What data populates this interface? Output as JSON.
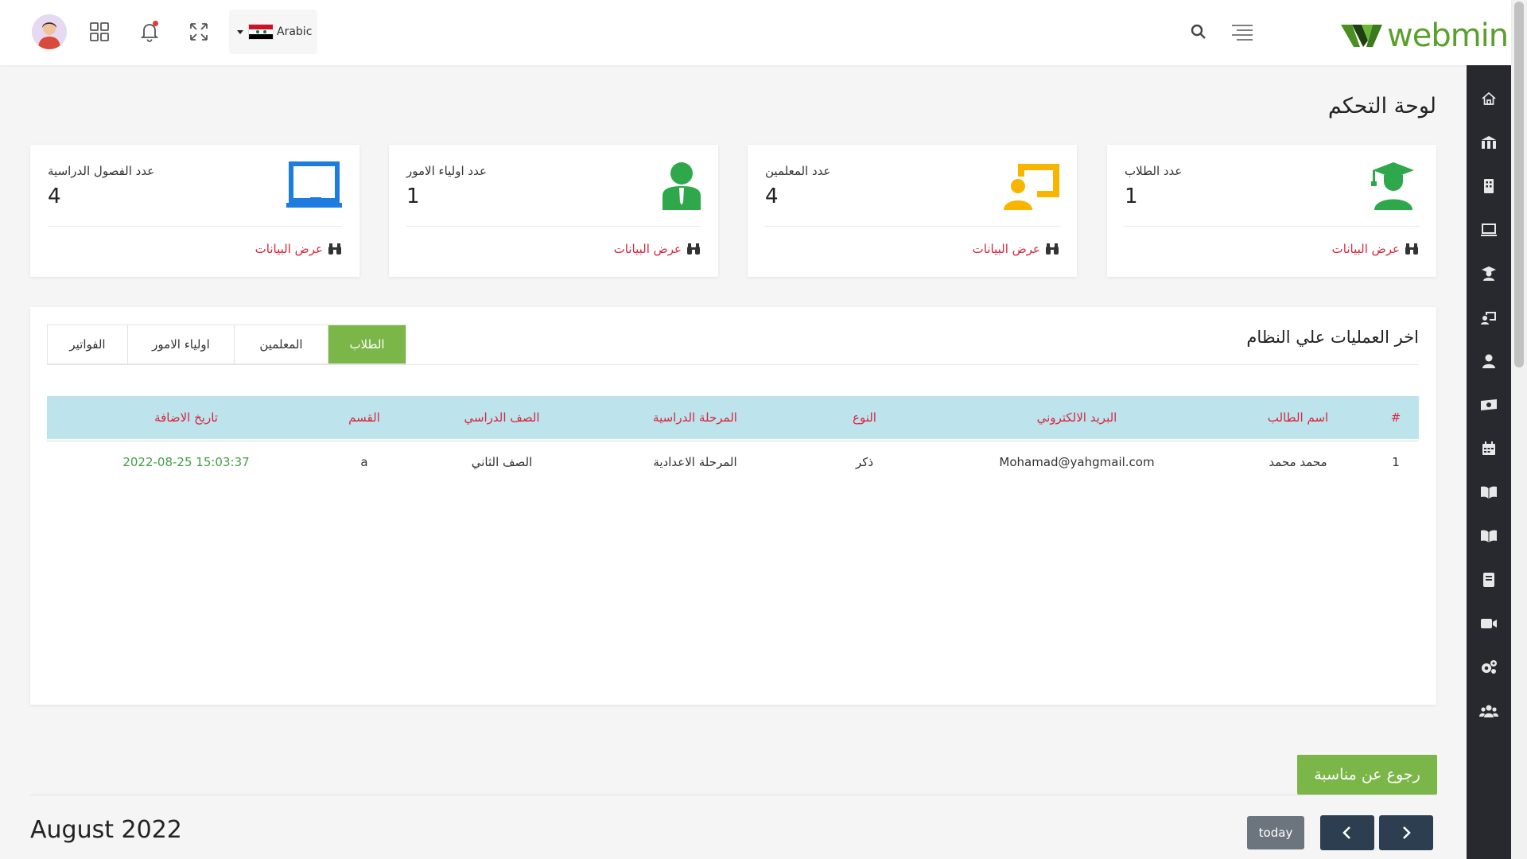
{
  "header": {
    "language_label": "Arabic",
    "logo_text": "webmin"
  },
  "page": {
    "title": "لوحة التحكم"
  },
  "cards": [
    {
      "label": "عدد الطلاب",
      "value": "1",
      "link": "عرض البيانات",
      "icon": "graduate-icon",
      "color": "#2ea84a"
    },
    {
      "label": "عدد المعلمين",
      "value": "4",
      "link": "عرض البيانات",
      "icon": "teacher-icon",
      "color": "#f7b500"
    },
    {
      "label": "عدد اولياء الامور",
      "value": "1",
      "link": "عرض البيانات",
      "icon": "parent-icon",
      "color": "#2ea84a"
    },
    {
      "label": "عدد الفصول الدراسية",
      "value": "4",
      "link": "عرض البيانات",
      "icon": "classroom-icon",
      "color": "#1e7be0"
    }
  ],
  "recent": {
    "title": "اخر العمليات علي النظام",
    "tabs": [
      "الطلاب",
      "المعلمين",
      "اولياء الامور",
      "الفواتير"
    ],
    "active_tab": "الطلاب",
    "columns": [
      "#",
      "اسم الطالب",
      "البريد الالكتروني",
      "النوع",
      "المرحلة الدراسية",
      "الصف الدراسي",
      "القسم",
      "تاريخ الاضافة"
    ],
    "rows": [
      [
        "1",
        "محمد محمد",
        "Mohamad@yahgmail.com",
        "ذكر",
        "المرحلة الاعدادية",
        "الصف الثاني",
        "a",
        "2022-08-25 15:03:37"
      ]
    ]
  },
  "calendar": {
    "back_button": "رجوع عن مناسبة",
    "month_title": "August 2022",
    "today_button": "today"
  },
  "sidebar_icons": [
    "home-icon",
    "school-icon",
    "building-icon",
    "laptop-icon",
    "graduate-icon",
    "teacher-board-icon",
    "user-icon",
    "money-icon",
    "calendar-icon",
    "book-open-icon",
    "book-open-alt-icon",
    "book-icon",
    "video-icon",
    "settings-icon",
    "users-icon"
  ],
  "colors": {
    "accent_green": "#7ab648",
    "link_red": "#d7263d",
    "table_header_bg": "#bde3ed",
    "sidebar_bg": "#27292e",
    "nav_button": "#2c3e50"
  }
}
